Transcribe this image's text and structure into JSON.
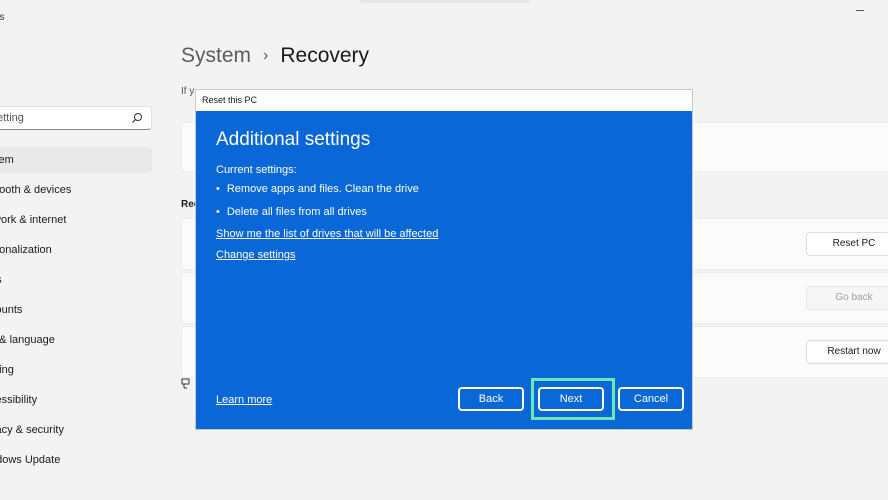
{
  "app": {
    "title": "gs"
  },
  "sidebar": {
    "search_value": "etting",
    "items": [
      {
        "label": "stem",
        "active": true
      },
      {
        "label": "etooth & devices"
      },
      {
        "label": "twork & internet"
      },
      {
        "label": "rsonalization"
      },
      {
        "label": "ps"
      },
      {
        "label": "counts"
      },
      {
        "label": "e & language"
      },
      {
        "label": "ming"
      },
      {
        "label": "cessibility"
      },
      {
        "label": "vacy & security"
      },
      {
        "label": "ndows Update"
      }
    ]
  },
  "main": {
    "breadcrumb_parent": "System",
    "breadcrumb_sep": "›",
    "breadcrumb_current": "Recovery",
    "description": "If y",
    "section_label": "Rec",
    "buttons": {
      "reset": "Reset PC",
      "go_back": "Go back",
      "restart": "Restart now"
    }
  },
  "dialog": {
    "window_title": "Reset this PC",
    "heading": "Additional settings",
    "current_label": "Current settings:",
    "bullets": [
      "Remove apps and files. Clean the drive",
      "Delete all files from all drives"
    ],
    "bullet_glyph": "•",
    "links": {
      "show_drives": "Show me the list of drives that will be affected",
      "change_settings": "Change settings",
      "learn_more": "Learn more"
    },
    "buttons": {
      "back": "Back",
      "next": "Next",
      "cancel": "Cancel"
    }
  },
  "colors": {
    "dialog_bg": "#0a67d8",
    "highlight": "#6ee6b3",
    "window_bg": "#f3f3f3"
  }
}
